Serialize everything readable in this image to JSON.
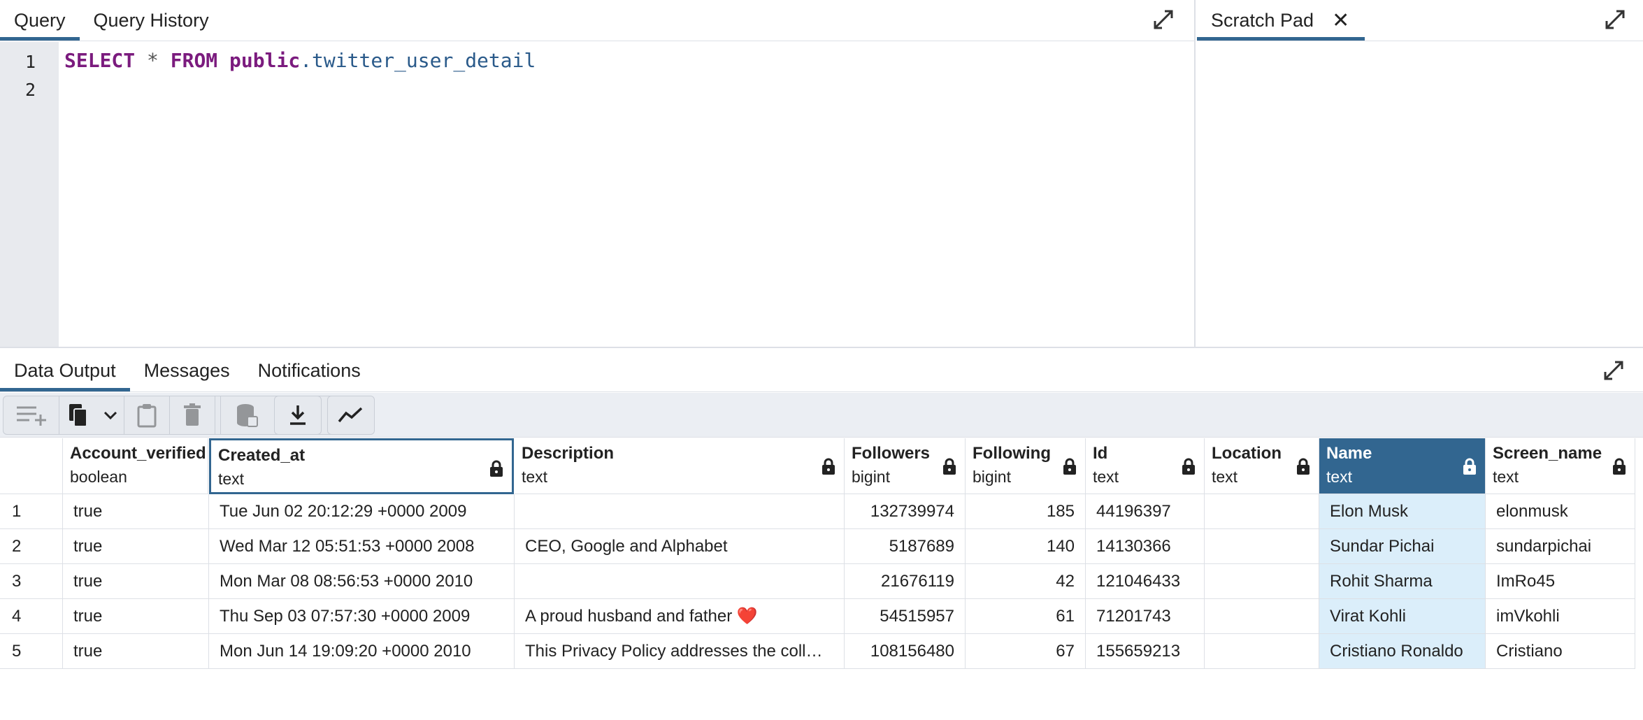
{
  "query_tabs": [
    {
      "label": "Query",
      "active": true
    },
    {
      "label": "Query History",
      "active": false
    }
  ],
  "scratch_tab": {
    "label": "Scratch Pad",
    "close": "✕"
  },
  "editor": {
    "line_numbers": [
      "1",
      "2"
    ],
    "sql": {
      "kw1": "SELECT",
      "star": " * ",
      "kw2": "FROM",
      "schema": " public",
      "dot": ".",
      "table": "twitter_user_detail"
    }
  },
  "output_tabs": [
    {
      "label": "Data Output",
      "active": true
    },
    {
      "label": "Messages",
      "active": false
    },
    {
      "label": "Notifications",
      "active": false
    }
  ],
  "toolbar_icons": [
    "add-row-icon",
    "copy-icon",
    "chevron-down-icon",
    "paste-icon",
    "delete-icon",
    "save-data-icon",
    "download-icon",
    "graph-icon"
  ],
  "columns": [
    {
      "name": "Account_verified",
      "type": "boolean"
    },
    {
      "name": "Created_at",
      "type": "text"
    },
    {
      "name": "Description",
      "type": "text"
    },
    {
      "name": "Followers",
      "type": "bigint"
    },
    {
      "name": "Following",
      "type": "bigint"
    },
    {
      "name": "Id",
      "type": "text"
    },
    {
      "name": "Location",
      "type": "text"
    },
    {
      "name": "Name",
      "type": "text"
    },
    {
      "name": "Screen_name",
      "type": "text"
    }
  ],
  "rows": [
    {
      "n": "1",
      "cells": [
        "true",
        "Tue Jun 02 20:12:29 +0000 2009",
        "",
        "132739974",
        "185",
        "44196397",
        "",
        "Elon Musk",
        "elonmusk"
      ]
    },
    {
      "n": "2",
      "cells": [
        "true",
        "Wed Mar 12 05:51:53 +0000 2008",
        "CEO, Google and Alphabet",
        "5187689",
        "140",
        "14130366",
        "",
        "Sundar Pichai",
        "sundarpichai"
      ]
    },
    {
      "n": "3",
      "cells": [
        "true",
        "Mon Mar 08 08:56:53 +0000 2010",
        "",
        "21676119",
        "42",
        "121046433",
        "",
        "Rohit Sharma",
        "ImRo45"
      ]
    },
    {
      "n": "4",
      "cells": [
        "true",
        "Thu Sep 03 07:57:30 +0000 2009",
        "A proud husband and father ❤️",
        "54515957",
        "61",
        "71201743",
        "",
        "Virat Kohli",
        "imVkohli"
      ]
    },
    {
      "n": "5",
      "cells": [
        "true",
        "Mon Jun 14 19:09:20 +0000 2010",
        "This Privacy Policy addresses the coll…",
        "108156480",
        "67",
        "155659213",
        "",
        "Cristiano Ronaldo",
        "Cristiano"
      ]
    }
  ],
  "colors": {
    "accent": "#326690",
    "selected_cell": "#dbeefa",
    "gutter": "#e8eaee",
    "keyword": "#7b1b7e",
    "identifier": "#2a5a8a"
  }
}
